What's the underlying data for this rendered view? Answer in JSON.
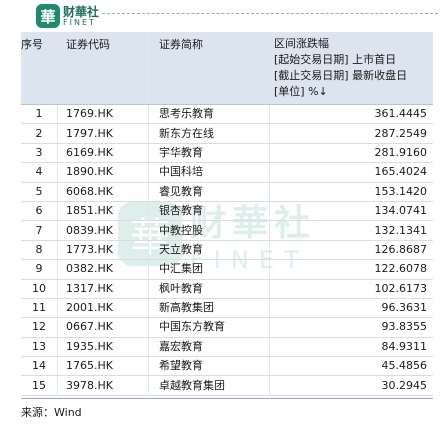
{
  "brand": {
    "logo_char": "華",
    "name_cn": "财華社",
    "name_en": "FINET"
  },
  "table": {
    "headers": {
      "index": "序号",
      "code": "证券代码",
      "name": "证券简称",
      "change_line1": "区间涨跌幅",
      "change_line2": "[起始交易日期] 上市首日",
      "change_line3": "[截止交易日期] 最新收盘日",
      "change_line4": "[单位] %↓"
    },
    "rows": [
      {
        "idx": "1",
        "code": "1769.HK",
        "name": "思考乐教育",
        "chg": "361.4445"
      },
      {
        "idx": "2",
        "code": "1797.HK",
        "name": "新东方在线",
        "chg": "287.2549"
      },
      {
        "idx": "3",
        "code": "6169.HK",
        "name": "宇华教育",
        "chg": "281.9160"
      },
      {
        "idx": "4",
        "code": "1890.HK",
        "name": "中国科培",
        "chg": "165.4024"
      },
      {
        "idx": "5",
        "code": "6068.HK",
        "name": "睿见教育",
        "chg": "153.1420"
      },
      {
        "idx": "6",
        "code": "1851.HK",
        "name": "银杏教育",
        "chg": "134.0741"
      },
      {
        "idx": "7",
        "code": "0839.HK",
        "name": "中教控股",
        "chg": "132.1341"
      },
      {
        "idx": "8",
        "code": "1773.HK",
        "name": "天立教育",
        "chg": "126.8687"
      },
      {
        "idx": "9",
        "code": "0382.HK",
        "name": "中汇集团",
        "chg": "122.6078"
      },
      {
        "idx": "10",
        "code": "1317.HK",
        "name": "枫叶教育",
        "chg": "102.6173"
      },
      {
        "idx": "11",
        "code": "2001.HK",
        "name": "新高教集团",
        "chg": "96.3631"
      },
      {
        "idx": "12",
        "code": "0667.HK",
        "name": "中国东方教育",
        "chg": "93.8355"
      },
      {
        "idx": "13",
        "code": "1935.HK",
        "name": "嘉宏教育",
        "chg": "84.9311"
      },
      {
        "idx": "14",
        "code": "1765.HK",
        "name": "希望教育",
        "chg": "45.4856"
      },
      {
        "idx": "15",
        "code": "3978.HK",
        "name": "卓越教育集团",
        "chg": "30.2945"
      }
    ]
  },
  "source": "来源：Wind",
  "watermark": {
    "logo_char": "華",
    "name_cn": "财華社",
    "name_en": "FINET"
  }
}
